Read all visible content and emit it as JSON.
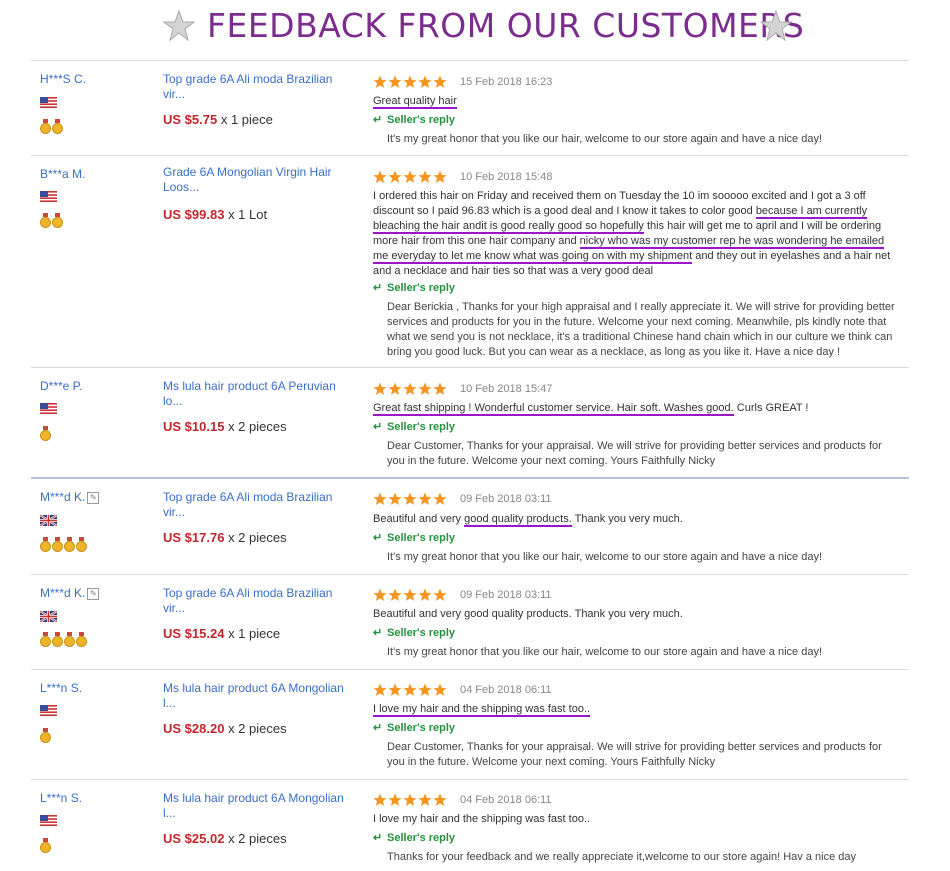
{
  "header": {
    "title": "FEEDBACK FROM OUR CUSTOMERS",
    "star_icon": "silver-star-icon"
  },
  "colors": {
    "title": "#7b2d8e",
    "link": "#3b6fc6",
    "price": "#c0282d",
    "reply": "#27923f",
    "highlight": "#9b15c9",
    "star": "#f79521"
  },
  "reviews": [
    {
      "buyer": "H***S C.",
      "flag": "us",
      "medals": 2,
      "product": "Top grade 6A Ali moda Brazilian vir...",
      "price": "US $5.75",
      "qty": "x 1 piece",
      "stars": 5,
      "date": "15 Feb 2018 16:23",
      "comment": [
        "Great quality hair"
      ],
      "reply_label": "Seller's reply",
      "reply": "It's my great honor that you like our hair, welcome to our store again and have a nice day!"
    },
    {
      "buyer": "B***a M.",
      "flag": "us",
      "medals": 2,
      "product": "Grade 6A Mongolian Virgin Hair Loos...",
      "price": "US $99.83",
      "qty": "x 1 Lot",
      "stars": 5,
      "date": "10 Feb 2018 15:48",
      "comment": [
        "I ordered this hair on Friday and received them on Tuesday the 10 im sooooo excited and I got a 3 off",
        "discount so I paid 96.83 which is a good deal and I know it takes to color good ",
        "because I am currently",
        "bleaching the hair andit is good really good so hopefully",
        " this hair will get me to april and I will be ordering",
        "more hair from this one hair company and ",
        "nicky who was my customer rep he was wondering he emailed",
        "me everyday to let me know what was going on with my shipment",
        " and they out in eyelashes and a hair net",
        "and a necklace and hair ties so that was a very good deal"
      ],
      "reply_label": "Seller's reply",
      "reply": "Dear Berickia , Thanks for your high appraisal and I really appreciate it. We will strive for providing better services and products for you in the future. Welcome your next coming. Meanwhile, pls kindly note that what we send you is not necklace, it's a traditional Chinese hand chain which in our culture we think can bring you good luck. But you can wear as a necklace, as long as you like it. Have a nice day !"
    },
    {
      "buyer": "D***e P.",
      "flag": "us",
      "medals": 1,
      "product": "Ms lula hair product 6A Peruvian lo...",
      "price": "US $10.15",
      "qty": "x 2 pieces",
      "stars": 5,
      "date": "10 Feb 2018 15:47",
      "comment": [
        "Great fast shipping ! Wonderful customer service. Hair soft. Washes good.",
        " Curls GREAT !"
      ],
      "reply_label": "Seller's reply",
      "reply": "Dear Customer, Thanks for your appraisal. We will strive for providing better services and products for you in the future. Welcome your next coming. Yours Faithfully Nicky"
    },
    {
      "buyer": "M***d K.",
      "flag": "uk",
      "medals": 4,
      "product": "Top grade 6A Ali moda Brazilian vir...",
      "price": "US $17.76",
      "qty": "x 2 pieces",
      "stars": 5,
      "date": "09 Feb 2018 03:11",
      "comment": [
        "Beautiful and very ",
        "good quality products.",
        " Thank you very much."
      ],
      "reply_label": "Seller's reply",
      "reply": "It's my great honor that you like our hair, welcome to our store again and have a nice day!"
    },
    {
      "buyer": "M***d K.",
      "flag": "uk",
      "medals": 4,
      "product": "Top grade 6A Ali moda Brazilian vir...",
      "price": "US $15.24",
      "qty": "x 1 piece",
      "stars": 5,
      "date": "09 Feb 2018 03:11",
      "comment": [
        "Beautiful and very good quality products. Thank you very much."
      ],
      "reply_label": "Seller's reply",
      "reply": "It's my great honor that you like our hair, welcome to our store again and have a nice day!"
    },
    {
      "buyer": "L***n S.",
      "flag": "us",
      "medals": 1,
      "product": "Ms lula hair product 6A Mongolian l...",
      "price": "US $28.20",
      "qty": "x 2 pieces",
      "stars": 5,
      "date": "04 Feb 2018 06:11",
      "comment": [
        "I love my hair and the shipping was fast too.."
      ],
      "reply_label": "Seller's reply",
      "reply": "Dear Customer, Thanks for your appraisal. We will strive for providing better services and products for you in the future. Welcome your next coming. Yours Faithfully Nicky"
    },
    {
      "buyer": "L***n S.",
      "flag": "us",
      "medals": 1,
      "product": "Ms lula hair product 6A Mongolian l...",
      "price": "US $25.02",
      "qty": "x 2 pieces",
      "stars": 5,
      "date": "04 Feb 2018 06:11",
      "comment": [
        "I love my hair and the shipping was fast too.."
      ],
      "reply_label": "Seller's reply",
      "reply": "Thanks for your feedback and we really appreciate it,welcome to our store again! Hav a nice day"
    }
  ]
}
